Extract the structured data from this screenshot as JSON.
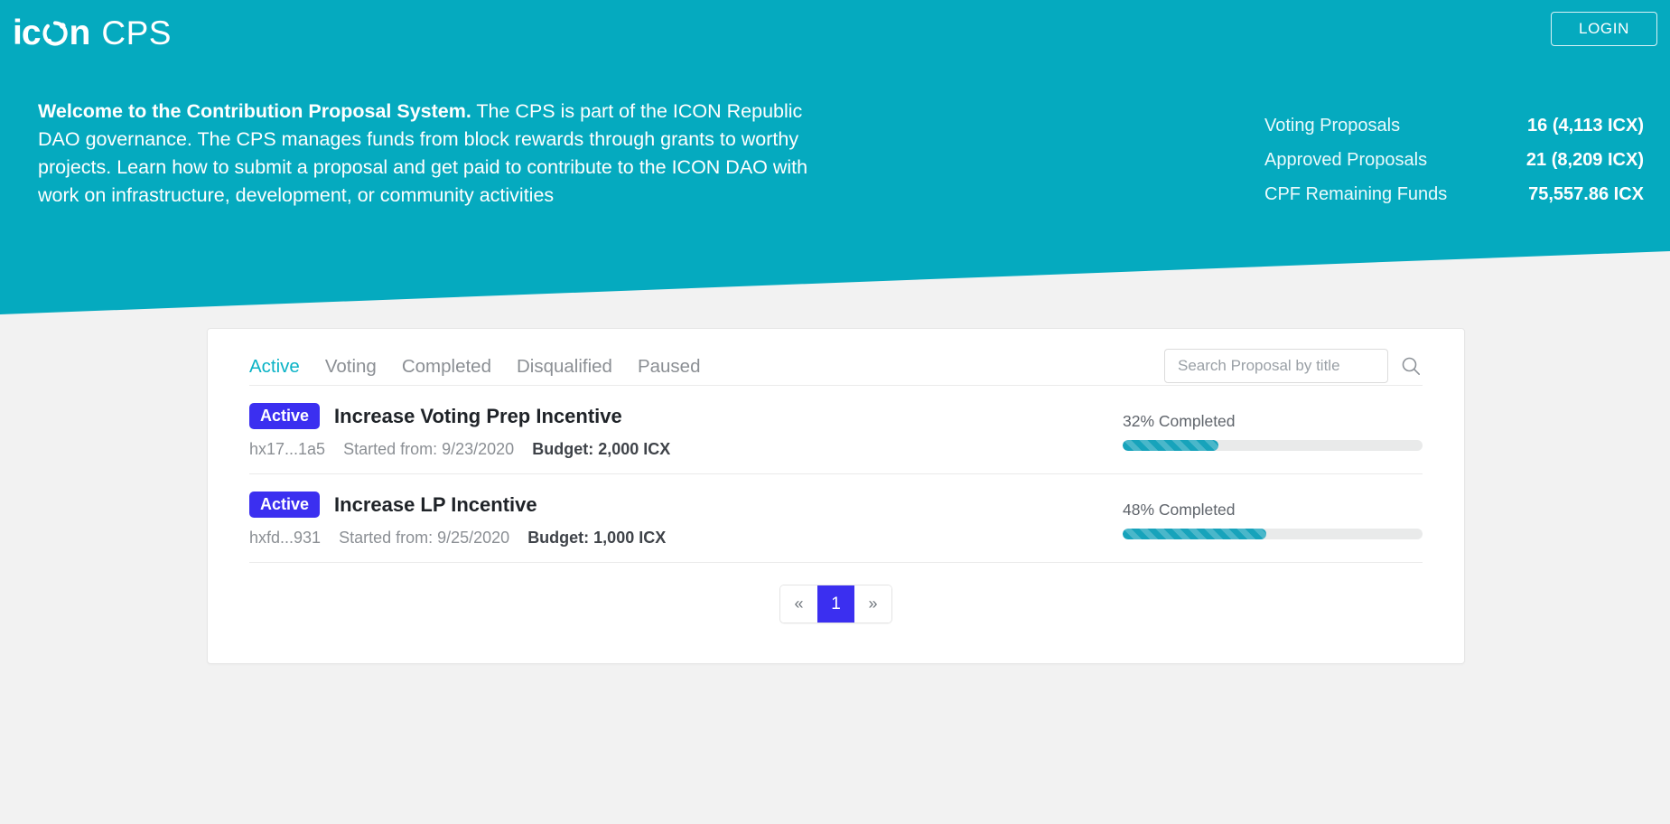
{
  "header": {
    "brand_icon": "ic",
    "brand_icon_tail": "n",
    "brand_suffix": "CPS",
    "login_label": "LOGIN"
  },
  "hero": {
    "welcome_bold": "Welcome to the Contribution Proposal System.",
    "welcome_rest": " The CPS is part of the ICON Republic DAO governance. The CPS manages funds from block rewards through grants to worthy projects. Learn how to submit a proposal and get paid to contribute to the ICON DAO with work on infrastructure, development, or community activities",
    "stats": [
      {
        "label": "Voting Proposals",
        "value": "16 (4,113 ICX)"
      },
      {
        "label": "Approved Proposals",
        "value": "21 (8,209 ICX)"
      },
      {
        "label": "CPF Remaining Funds",
        "value": "75,557.86 ICX"
      }
    ]
  },
  "main": {
    "tabs": [
      {
        "label": "Active",
        "active": true
      },
      {
        "label": "Voting",
        "active": false
      },
      {
        "label": "Completed",
        "active": false
      },
      {
        "label": "Disqualified",
        "active": false
      },
      {
        "label": "Paused",
        "active": false
      }
    ],
    "search": {
      "placeholder": "Search Proposal by title",
      "value": ""
    },
    "proposals": [
      {
        "status": "Active",
        "title": "Increase Voting Prep Incentive",
        "address": "hx17...1a5",
        "started": "Started from: 9/23/2020",
        "budget": "Budget: 2,000 ICX",
        "progress_label": "32% Completed",
        "progress_percent": 32
      },
      {
        "status": "Active",
        "title": "Increase LP Incentive",
        "address": "hxfd...931",
        "started": "Started from: 9/25/2020",
        "budget": "Budget: 1,000 ICX",
        "progress_label": "48% Completed",
        "progress_percent": 48
      }
    ],
    "pagination": {
      "prev": "«",
      "current": "1",
      "next": "»"
    }
  },
  "colors": {
    "brand_teal": "#05aabf",
    "tab_active": "#0bb3c6",
    "badge_blue": "#3b2ff0",
    "progress_teal": "#17a3bb",
    "page_bg": "#f2f2f2"
  }
}
